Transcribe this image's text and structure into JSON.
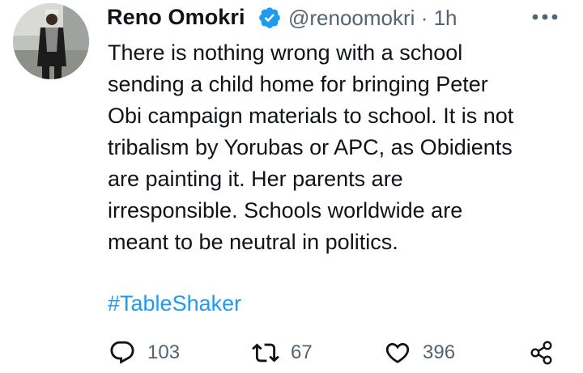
{
  "tweet": {
    "author": {
      "name": "Reno Omokri",
      "handle": "@renoomokri",
      "separator": "·",
      "time": "1h",
      "verified": true,
      "avatar_icon": "profile-photo"
    },
    "text_lines": [
      "There is nothing wrong with a school",
      "sending a child home for bringing Peter",
      "Obi campaign materials to school. It is not",
      "tribalism by Yorubas or APC, as Obidients",
      "are painting it. Her parents are",
      "irresponsible. Schools worldwide are",
      "meant to be neutral in politics."
    ],
    "hashtag": "#TableShaker",
    "stats": {
      "replies": "103",
      "retweets": "67",
      "likes": "396"
    }
  },
  "icons": {
    "verified": "verified-badge-icon",
    "more": "more-options-icon",
    "reply": "reply-icon",
    "retweet": "retweet-icon",
    "like": "heart-icon",
    "share": "share-icon"
  },
  "colors": {
    "text": "#0f1419",
    "secondary": "#536471",
    "accent": "#1d9bf0",
    "background": "#ffffff"
  }
}
